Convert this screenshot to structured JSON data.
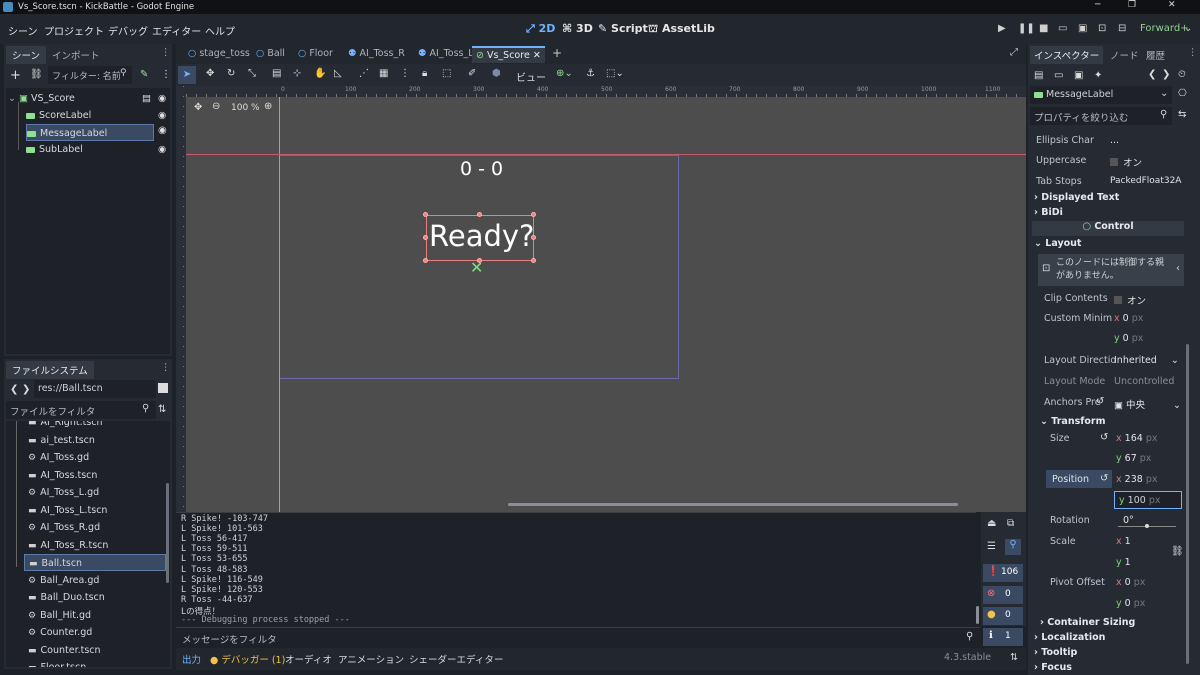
{
  "window": {
    "title": "Vs_Score.tscn - KickBattle - Godot Engine",
    "minimize": "─",
    "maximize": "❐",
    "close": "✕"
  },
  "menus": [
    "シーン",
    "プロジェクト",
    "デバッグ",
    "エディター",
    "ヘルプ"
  ],
  "modes": {
    "d2": "2D",
    "d3": "3D",
    "script": "Script",
    "assetlib": "AssetLib"
  },
  "renderer": "Forward+",
  "scene_panel": {
    "tabs": [
      "シーン",
      "インポート"
    ],
    "filter_placeholder": "フィルター: 名前",
    "root": "VS_Score",
    "children": [
      "ScoreLabel",
      "MessageLabel",
      "SubLabel"
    ],
    "selected": "MessageLabel"
  },
  "filesystem": {
    "title": "ファイルシステム",
    "path": "res://Ball.tscn",
    "filter_placeholder": "ファイルをフィルタ",
    "files": [
      "AI_Right.tscn",
      "ai_test.tscn",
      "AI_Toss.gd",
      "AI_Toss.tscn",
      "AI_Toss_L.gd",
      "AI_Toss_L.tscn",
      "AI_Toss_R.gd",
      "AI_Toss_R.tscn",
      "Ball.tscn",
      "Ball_Area.gd",
      "Ball_Duo.tscn",
      "Ball_Hit.gd",
      "Counter.gd",
      "Counter.tscn",
      "Floor.tscn"
    ],
    "selected": "Ball.tscn"
  },
  "scene_tabs": [
    "stage_toss",
    "Ball",
    "Floor",
    "AI_Toss_R",
    "AI_Toss_L",
    "Vs_Score"
  ],
  "active_scene_tab": "Vs_Score",
  "toolbar": {
    "view": "ビュー"
  },
  "ruler_labels": [
    "0",
    "100",
    "200",
    "300",
    "400",
    "500",
    "600",
    "700",
    "800",
    "900",
    "1000",
    "1100"
  ],
  "zoom": "100 %",
  "viewport": {
    "score_text": "0 - 0",
    "message_text": "Ready?"
  },
  "log_lines": [
    "R Spike! -103-747",
    "L Spike! 101-563",
    "L Toss 56-417",
    "L Toss 59-511",
    "L Toss 53-655",
    "L Toss 48-583",
    "L Spike! 116-549",
    "L Spike! 120-553",
    "R Toss -44-637",
    "Lの得点！",
    "--- Debugging process stopped ---"
  ],
  "log_filter_placeholder": "メッセージをフィルタ",
  "log_counts": {
    "messages": "106",
    "errors": "0",
    "warnings": "0",
    "info": "1"
  },
  "bottom_tabs": [
    "出力",
    "デバッガー (1)",
    "オーディオ",
    "アニメーション",
    "シェーダーエディター"
  ],
  "version": "4.3.stable",
  "inspector": {
    "tabs": [
      "インスペクター",
      "ノード",
      "履歴"
    ],
    "node": "MessageLabel",
    "filter_placeholder": "プロパティを絞り込む",
    "ellipsis_char": {
      "label": "Ellipsis Char",
      "value": "..."
    },
    "uppercase": {
      "label": "Uppercase",
      "value": "オン"
    },
    "tab_stops": {
      "label": "Tab Stops",
      "value": "PackedFloat32A"
    },
    "sections": {
      "displayed_text": "Displayed Text",
      "bidi": "BiDi",
      "control": "Control",
      "layout": "Layout",
      "transform": "Transform",
      "container_sizing": "Container Sizing",
      "localization": "Localization",
      "tooltip": "Tooltip",
      "focus": "Focus"
    },
    "layout_warning": "このノードには制御する親がありません。",
    "clip_contents": {
      "label": "Clip Contents",
      "value": "オン"
    },
    "custom_min": {
      "label": "Custom Minim",
      "x": "0",
      "y": "0",
      "unit": "px"
    },
    "layout_direction": {
      "label": "Layout Directio",
      "value": "Inherited"
    },
    "layout_mode": {
      "label": "Layout Mode",
      "value": "Uncontrolled"
    },
    "anchors": {
      "label": "Anchors Pre",
      "value": "中央"
    },
    "size": {
      "label": "Size",
      "x": "164",
      "y": "67",
      "unit": "px"
    },
    "position": {
      "label": "Position",
      "x": "238",
      "y": "100",
      "unit": "px"
    },
    "rotation": {
      "label": "Rotation",
      "value": "0",
      "unit": "°"
    },
    "scale": {
      "label": "Scale",
      "x": "1",
      "y": "1"
    },
    "pivot": {
      "label": "Pivot Offset",
      "x": "0",
      "y": "0",
      "unit": "px"
    }
  },
  "colors": {
    "accent": "#6fb2ff",
    "selection": "#3b4a63",
    "viewport_bg": "#4d4d4d"
  }
}
